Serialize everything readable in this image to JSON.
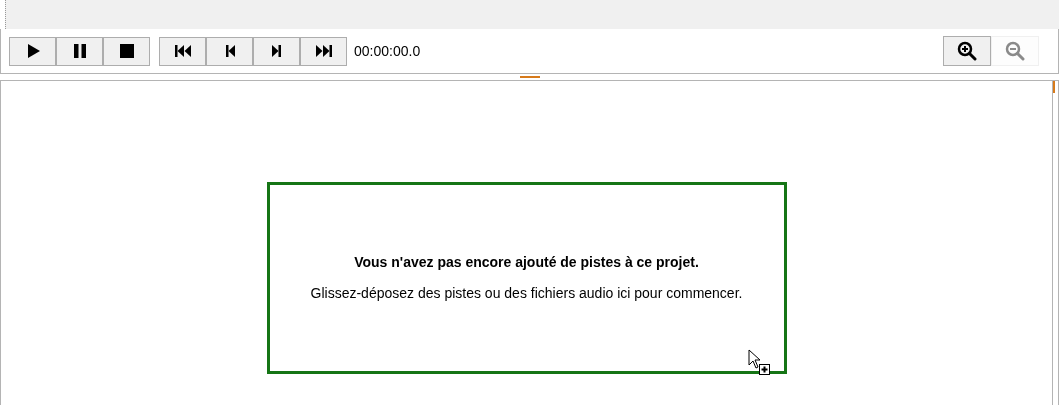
{
  "transport": {
    "playback": [
      {
        "kind": "play"
      },
      {
        "kind": "pause"
      },
      {
        "kind": "stop"
      }
    ],
    "navigation": [
      {
        "kind": "first"
      },
      {
        "kind": "previous"
      },
      {
        "kind": "next"
      },
      {
        "kind": "last"
      }
    ],
    "time": "00:00:00.0"
  },
  "zoom": [
    {
      "kind": "in",
      "disabled": false
    },
    {
      "kind": "out",
      "disabled": true
    }
  ],
  "drop_zone": {
    "title": "Vous n'avez pas encore ajouté de pistes à ce projet.",
    "hint": "Glissez-déposez des pistes ou des fichiers audio ici pour commencer."
  }
}
